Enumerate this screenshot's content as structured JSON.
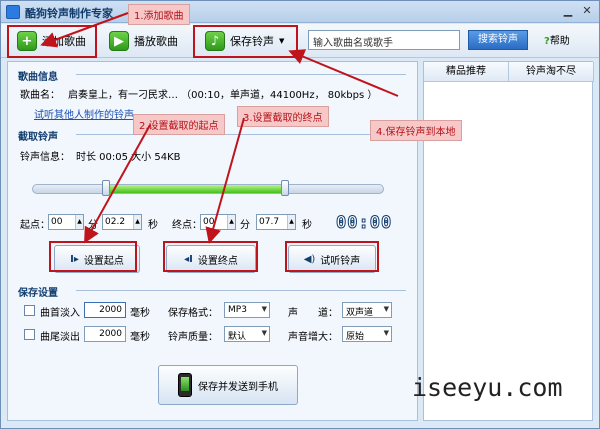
{
  "window": {
    "title": "酷狗铃声制作专家",
    "min_icon": "minimize-icon",
    "close_icon": "close-icon"
  },
  "toolbar": {
    "add_label": "添加歌曲",
    "play_label": "播放歌曲",
    "save_label": "保存铃声",
    "search_placeholder": "输入歌曲名或歌手",
    "search_button": "搜索铃声",
    "help": "帮助"
  },
  "right_tabs": [
    "精品推荐",
    "铃声淘不尽"
  ],
  "song_info": {
    "section": "歌曲信息",
    "label": "歌曲名：",
    "value": "启奏皇上，有一刁民求…  （00:10，单声道，44100Hz， 80kbps ）",
    "link": "试听其他人制作的铃声"
  },
  "crop": {
    "section": "截取铃声",
    "info_label": "铃声信息：",
    "info_value": "时长 00:05 大小  54KB",
    "start_label": "起点：",
    "start_min": "00",
    "min_unit": "分",
    "start_sec": "02.2",
    "sec_unit": "秒",
    "end_label": "终点：",
    "end_min": "00",
    "end_sec": "07.7",
    "timer": "00:00",
    "btn_start": "设置起点",
    "btn_end": "设置终点",
    "btn_listen": "试听铃声",
    "slider_start": 0.21,
    "slider_end": 0.72
  },
  "save": {
    "section": "保存设置",
    "fadein_label": "曲首淡入",
    "fadein_value": "2000",
    "ms_unit": "毫秒",
    "fadeout_label": "曲尾淡出",
    "fadeout_value": "2000",
    "format_label": "保存格式：",
    "format_value": "MP3",
    "quality_label": "铃声质量：",
    "quality_value": "默认",
    "channel_label": "声　　道：",
    "channel_value": "双声道",
    "gain_label": "声音增大：",
    "gain_value": "原始",
    "send_button": "保存并发送到手机"
  },
  "callouts": {
    "c1": "1.添加歌曲",
    "c2": "2.设置截取的起点",
    "c3": "3.设置截取的终点",
    "c4": "4.保存铃声到本地"
  },
  "watermark": "iseeyu.com",
  "colors": {
    "accent": "#2c7be0",
    "annotation": "#c0141c",
    "progress": "#42c01a"
  }
}
